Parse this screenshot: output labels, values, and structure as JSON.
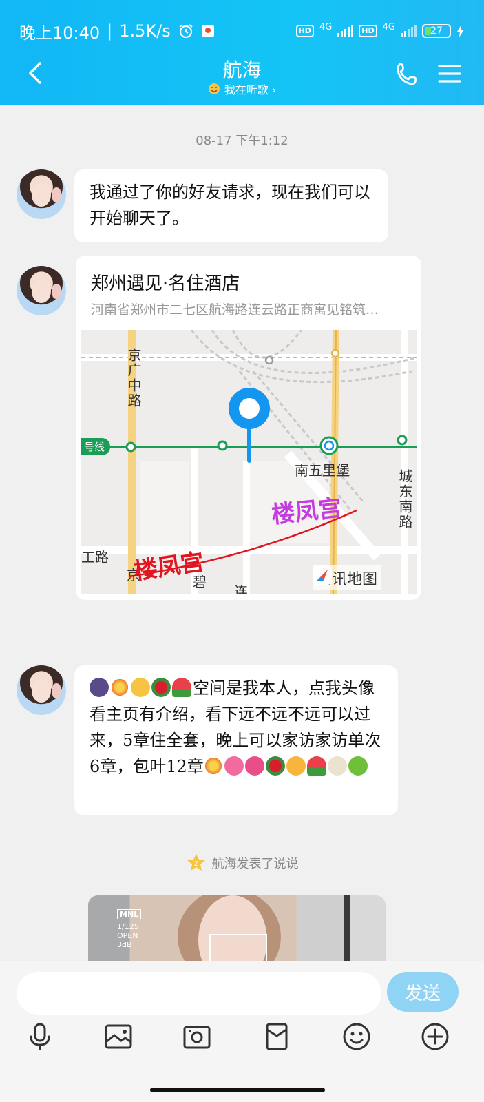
{
  "status_bar": {
    "time": "晚上10:40",
    "speed": "1.5K/s",
    "network1": "4G",
    "network2": "4G",
    "hd_label": "HD",
    "battery": "27"
  },
  "header": {
    "title": "航海",
    "subtitle": "我在听歌 ›"
  },
  "chat": {
    "timestamp": "08-17 下午1:12",
    "message1": "我通过了你的好友请求，现在我们可以开始聊天了。",
    "location": {
      "name": "郑州遇见·名住酒店",
      "address": "河南省郑州市二七区航海路连云路正商寓见铭筑…",
      "map_labels": {
        "road_jingguang": "京广中路",
        "station": "南五里堡",
        "road_chengdongnan": "城东南路",
        "line_badge": "号线",
        "road_left": "工路",
        "road_bi": "碧",
        "road_lian": "连",
        "road_jing2": "京",
        "watermark1": "楼凤宫",
        "watermark2": "楼凤宫",
        "provider": "腾讯地图"
      }
    },
    "message3": "空间是我本人，点我头像看主页有介绍，看下远不远不远可以过来，5章住全套，晚上可以家访家访单次6章，包叶12章",
    "notice": "航海发表了说说",
    "photo_osd": [
      "MNL",
      "1/125",
      "OPEN",
      "3dB"
    ]
  },
  "input_bar": {
    "placeholder": "",
    "send_label": "发送"
  },
  "colors": {
    "header_blue": "#12b7f5",
    "send_button": "#8fd3f5",
    "map_pin": "#1296f0",
    "metro_line": "#1a9e55"
  }
}
